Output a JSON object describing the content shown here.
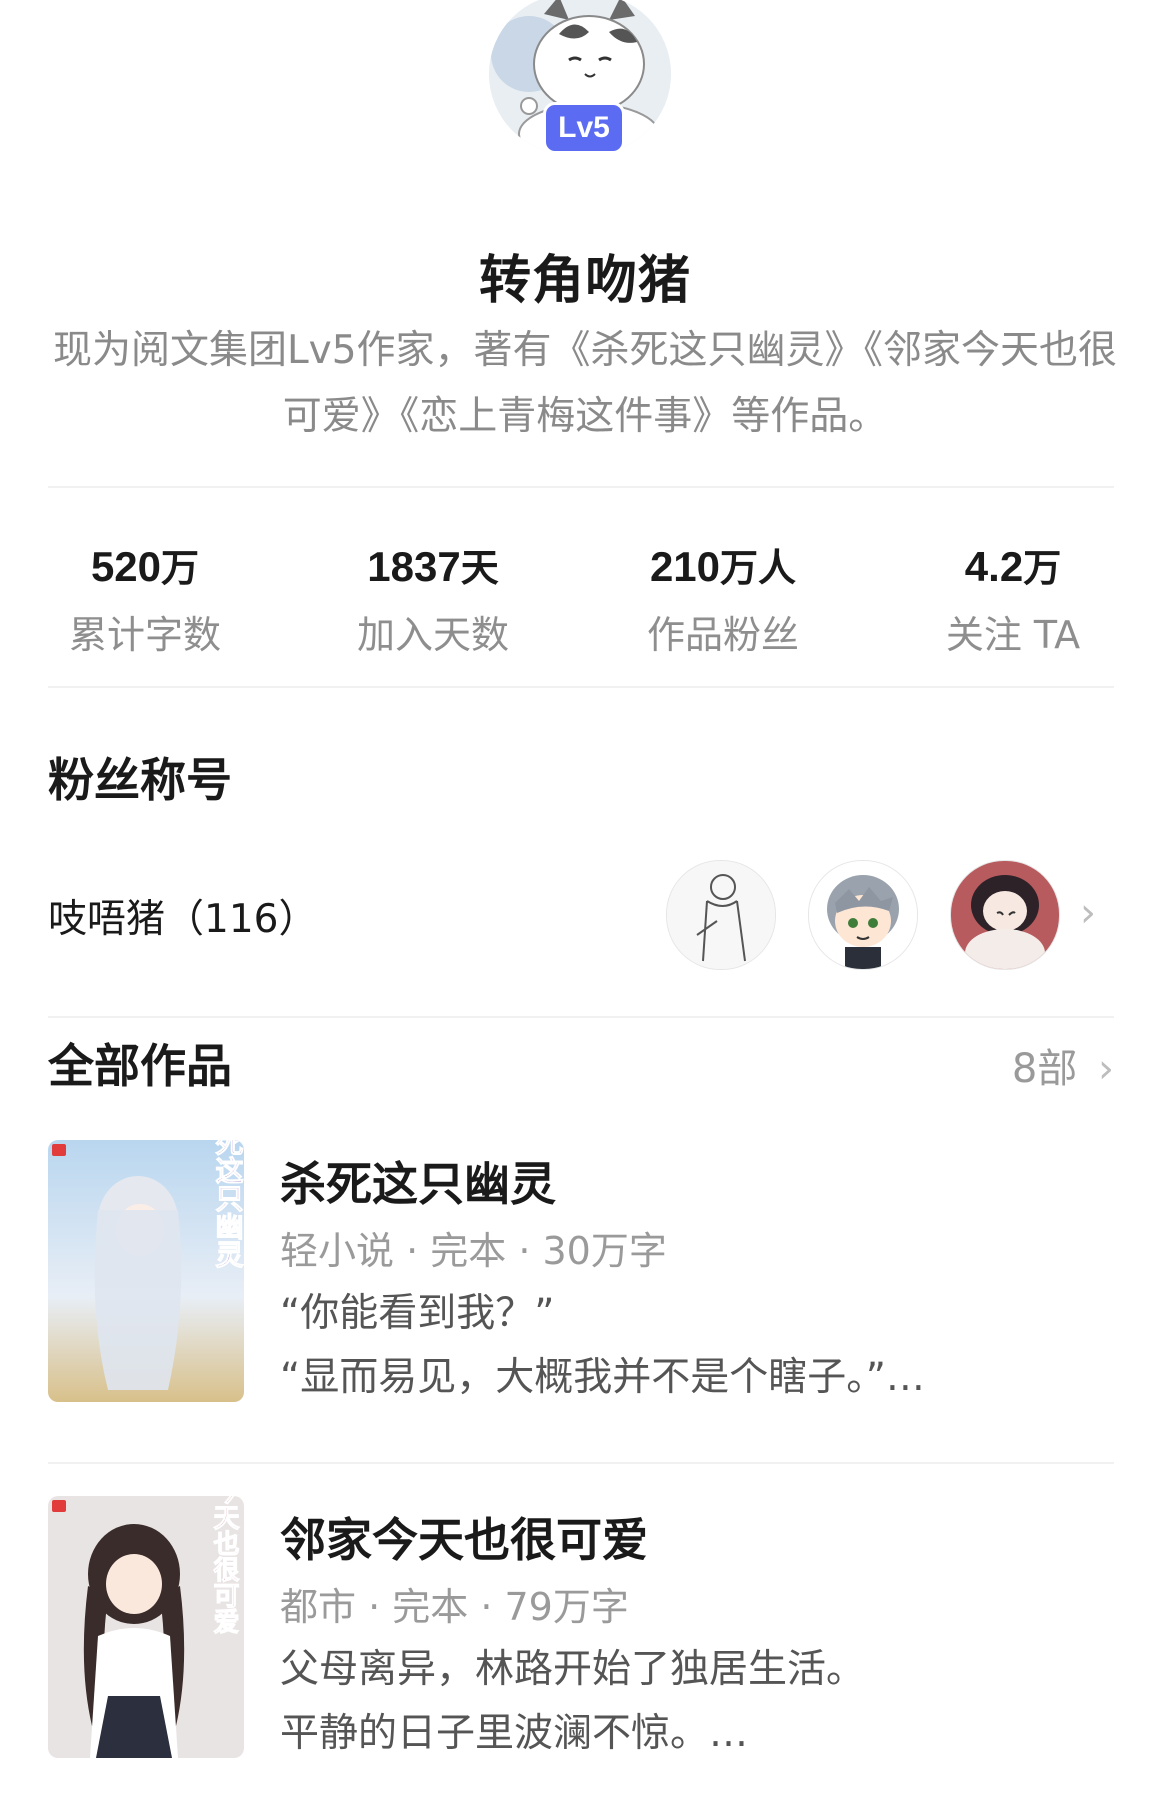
{
  "profile": {
    "level_badge": "Lv5",
    "name": "转角吻猪",
    "bio": "现为阅文集团Lv5作家，著有《杀死这只幽灵》《邻家今天也很可爱》《恋上青梅这件事》等作品。"
  },
  "stats": [
    {
      "value": "520",
      "unit": "万",
      "label": "累计字数"
    },
    {
      "value": "1837",
      "unit": "天",
      "label": "加入天数"
    },
    {
      "value": "210",
      "unit": "万人",
      "label": "作品粉丝"
    },
    {
      "value": "4.2",
      "unit": "万",
      "label": "关注 TA"
    }
  ],
  "fans": {
    "section_title": "粉丝称号",
    "fan_name": "吱唔猪（116）",
    "avatar_icons": [
      "sketch-figure-avatar",
      "grey-hair-boy-avatar",
      "dark-hair-girl-avatar"
    ]
  },
  "works": {
    "section_title": "全部作品",
    "count_label": "8部",
    "books": [
      {
        "title": "杀死这只幽灵",
        "meta": "轻小说 · 完本 · 30万字",
        "desc_line1": "“你能看到我？”",
        "desc_line2": "“显而易见，大概我并不是个瞎子。”…",
        "cover_text": "杀死这只幽灵"
      },
      {
        "title": "邻家今天也很可爱",
        "meta": "都市 · 完本 · 79万字",
        "desc_line1": "父母离异，林路开始了独居生活。",
        "desc_line2": "平静的日子里波澜不惊。…",
        "cover_text": "邻家今天也很可爱"
      }
    ]
  },
  "colors": {
    "level_badge": "#5b6cf2",
    "primary_text": "#1a1a1a",
    "secondary_text": "#8a8a8a"
  }
}
